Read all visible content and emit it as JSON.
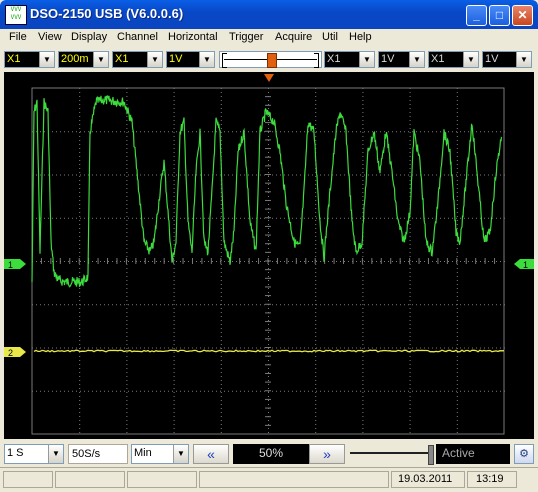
{
  "window": {
    "title": "DSO-2150 USB (V6.0.0.6)",
    "icon_text": "VVV VVV"
  },
  "menu": [
    "File",
    "View",
    "Display",
    "Channel",
    "Horizontal",
    "Trigger",
    "Acquire",
    "Util",
    "Help"
  ],
  "toolbar": {
    "ch1_probe": "X1",
    "ch1_timebase": "200m",
    "ch1b_probe": "X1",
    "ch1_volts": "1V",
    "ch2_probe": "X1",
    "ch2_volts": "1V",
    "ch3_probe": "X1",
    "ch3_volts": "1V"
  },
  "markers": {
    "ch1": "1",
    "ch2": "2",
    "trigger_left": "1",
    "trigger_right": "1"
  },
  "bottom": {
    "time_div": "1 S",
    "sample_rate": "50S/s",
    "mode": "Min",
    "percent": "50%",
    "status": "Active",
    "prev_icon": "double-left-arrow",
    "next_icon": "double-right-arrow"
  },
  "status": {
    "date": "19.03.2011",
    "time": "13:19"
  },
  "colors": {
    "ch1_trace": "#3ddc3d",
    "ch2_trace": "#e8e84a",
    "grid": "#7a7a7a",
    "screen_bg": "#000000",
    "titlebar": "#0a50d8"
  }
}
